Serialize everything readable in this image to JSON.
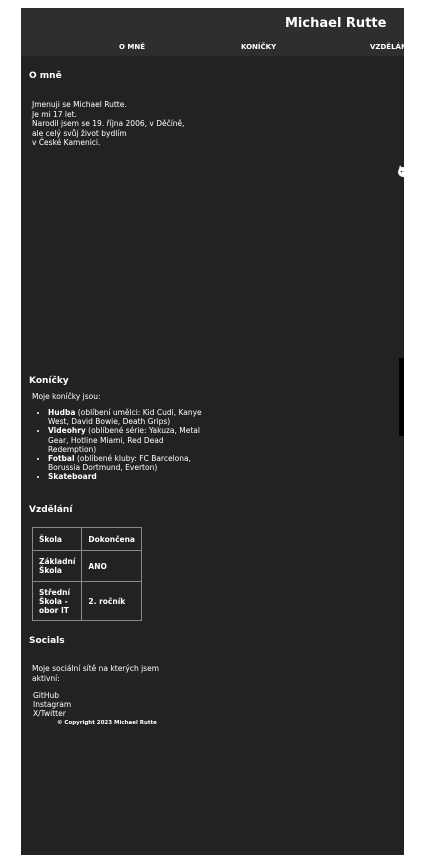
{
  "site": {
    "title": "Michael Rutte"
  },
  "nav": {
    "items": [
      "O MNĚ",
      "KONÍČKY",
      "VZDĚLÁNÍ"
    ]
  },
  "about": {
    "heading": "O mně",
    "lines": [
      "Jmenuji se Michael Rutte.",
      "Je mi 17 let.",
      "Narodil jsem se 19. října 2006, v Děčíně,",
      "ale celý svůj život bydlím",
      "v České Kamenici."
    ]
  },
  "hobbies": {
    "heading": "Koníčky",
    "intro": "Moje koníčky jsou:",
    "items": [
      {
        "name": "Hudba",
        "detail": " (oblíbení umělci: Kid Cudi, Kanye West, David Bowie, Death Grips)"
      },
      {
        "name": "Videohry",
        "detail": " (oblíbené série: Yakuza, Metal Gear, Hotline Miami, Red Dead Redemption)"
      },
      {
        "name": "Fotbal",
        "detail": " (oblíbené kluby: FC Barcelona, Borussia Dortmund, Everton)"
      },
      {
        "name": "Skateboard",
        "detail": ""
      }
    ]
  },
  "education": {
    "heading": "Vzdělání",
    "headers": [
      "Škola",
      "Dokončena"
    ],
    "rows": [
      [
        "Základní Škola",
        "ANO"
      ],
      [
        "Střední Škola - obor IT",
        "2. ročník"
      ]
    ]
  },
  "socials": {
    "heading": "Socials",
    "intro_lines": [
      "Moje sociální sítě na kterých jsem",
      "aktivní:"
    ],
    "links": [
      "GitHub",
      "Instagram",
      "X/Twitter"
    ]
  },
  "footer": {
    "copyright": "© Copyright 2023 Michael Rutte"
  },
  "colors": {
    "page_bg": "#222222",
    "header_bg": "#2e2e2e",
    "text": "#ffffff",
    "outer_bg": "#ffffff"
  }
}
